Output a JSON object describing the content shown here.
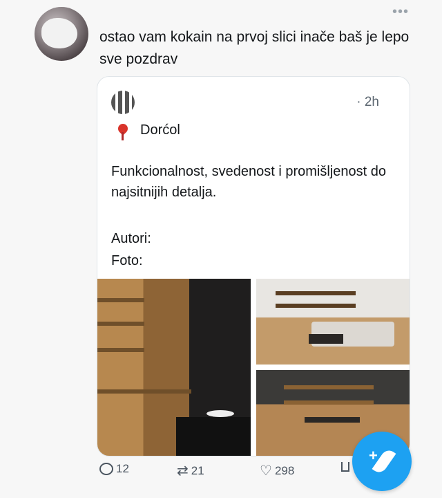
{
  "tweet": {
    "text": "ostao vam kokain na prvoj slici inače baš je lepo sve pozdrav",
    "more_icon": "more-icon"
  },
  "quoted": {
    "time": "· 2h",
    "location": "Dorćol",
    "body": "Funkcionalnost, svedenost i promišljenost do najsitnijih detalja.",
    "authors_label": "Autori:",
    "photo_label": "Foto:"
  },
  "actions": {
    "reply_count": "12",
    "retweet_count": "21",
    "like_count": "298"
  },
  "colors": {
    "accent": "#1da1f2",
    "pin": "#d9342b"
  }
}
